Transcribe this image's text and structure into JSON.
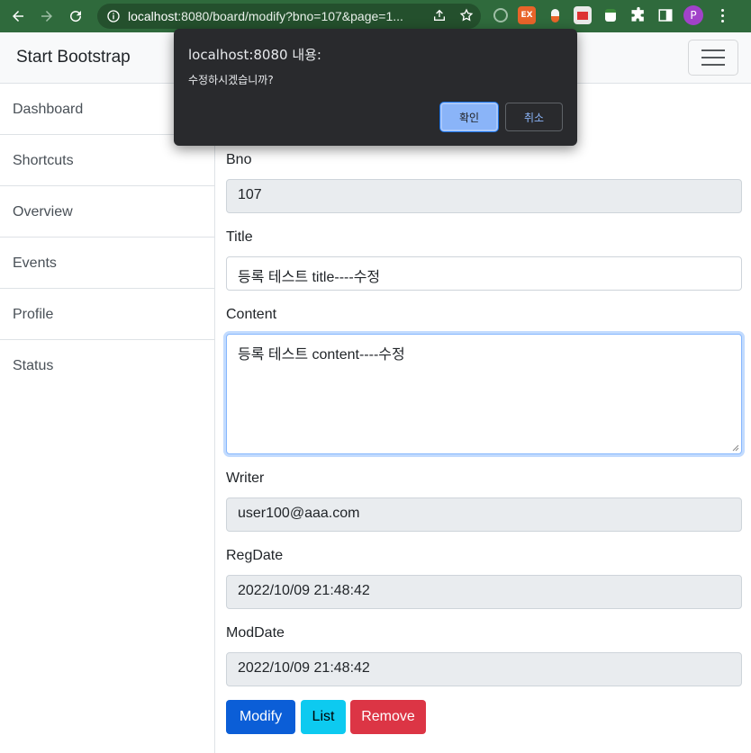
{
  "browser": {
    "url_host": "localhost",
    "url_rest": ":8080/board/modify?bno=107&page=1...",
    "avatar_letter": "P",
    "ext_label": "EX"
  },
  "navbar": {
    "brand": "Start Bootstrap"
  },
  "sidebar": {
    "items": [
      {
        "label": "Dashboard"
      },
      {
        "label": "Shortcuts"
      },
      {
        "label": "Overview"
      },
      {
        "label": "Events"
      },
      {
        "label": "Profile"
      },
      {
        "label": "Status"
      }
    ]
  },
  "form": {
    "bno": {
      "label": "Bno",
      "value": "107"
    },
    "title": {
      "label": "Title",
      "value": "등록 테스트 title----수정"
    },
    "content": {
      "label": "Content",
      "value": "등록 테스트 content----수정"
    },
    "writer": {
      "label": "Writer",
      "value": "user100@aaa.com"
    },
    "regdate": {
      "label": "RegDate",
      "value": "2022/10/09 21:48:42"
    },
    "moddate": {
      "label": "ModDate",
      "value": "2022/10/09 21:48:42"
    }
  },
  "buttons": {
    "modify": "Modify",
    "list": "List",
    "remove": "Remove"
  },
  "dialog": {
    "title": "localhost:8080 내용:",
    "message": "수정하시겠습니까?",
    "ok": "확인",
    "cancel": "취소"
  },
  "colors": {
    "chrome": "#2f6a3c",
    "primary": "#0d6efd",
    "info": "#0dcaf0",
    "danger": "#dc3545"
  }
}
